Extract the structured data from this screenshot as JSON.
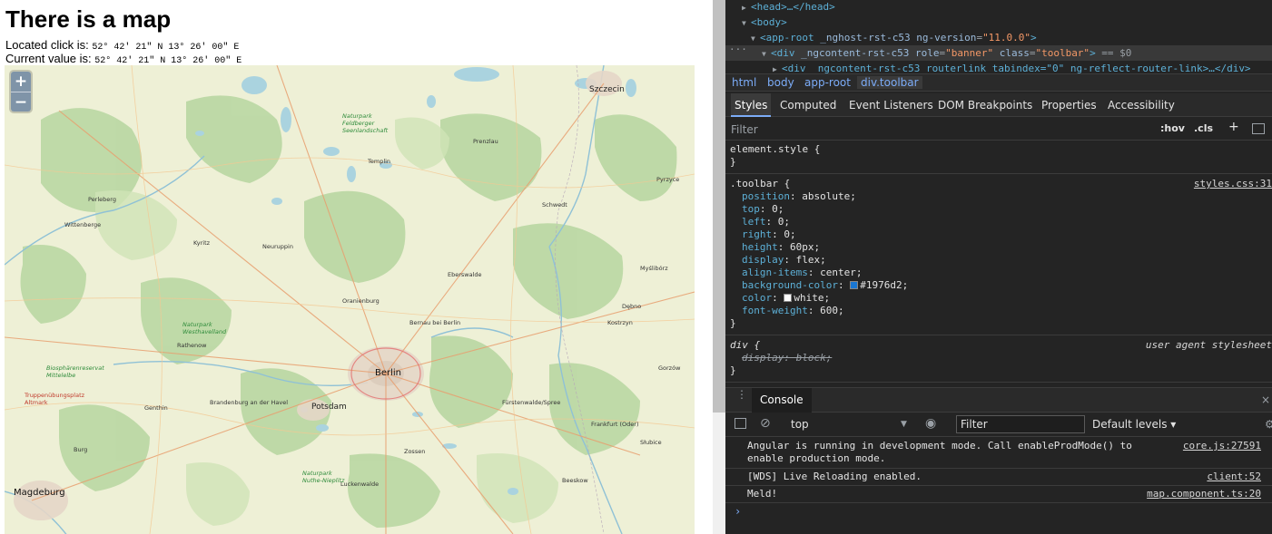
{
  "page": {
    "title": "There is a map",
    "located_label": "Located click is:",
    "located_value": "52° 42′ 21″ N 13° 26′ 00″ E",
    "current_label": "Current value is:",
    "current_value": "52° 42′ 21″ N 13° 26′ 00″ E"
  },
  "map": {
    "zoom_in": "+",
    "zoom_out": "−",
    "labels": {
      "szczecin": "Szczecin",
      "berlin": "Berlin",
      "potsdam": "Potsdam",
      "magdeburg": "Magdeburg",
      "wittenberge": "Wittenberge",
      "oranienburg": "Oranienburg",
      "eberswalde": "Eberswalde",
      "schwedt": "Schwedt",
      "neuruppin": "Neuruppin",
      "rathenow": "Rathenow",
      "brandenburg": "Brandenburg an der Havel",
      "frankfurt": "Frankfurt (Oder)",
      "prenzlau": "Prenzlau",
      "pyrzyce": "Pyrzyce",
      "luckenwalde": "Luckenwalde",
      "fuerstenwalde": "Fürstenwalde/Spree",
      "bernau": "Bernau bei Berlin",
      "templin": "Templin",
      "kyritz": "Kyritz",
      "perleberg": "Perleberg",
      "genthin": "Genthin",
      "burg": "Burg",
      "zossen": "Zossen",
      "beeskow": "Beeskow",
      "slubice": "Słubice",
      "kostrzyn": "Kostrzyn",
      "mysliborz": "Myślibórz",
      "debno": "Dębno",
      "gorzow": "Gorzów",
      "park_feldberg": "Naturpark Feldberger Seenlandschaft",
      "park_westhavelland": "Naturpark Westhavelland",
      "park_nuthe": "Naturpark Nuthe-Nieplitz",
      "park_elbe": "Biosphärenreservat Mittelelbe",
      "red_label": "Truppenübungsplatz Altmark"
    }
  },
  "devtools": {
    "dom": {
      "line1_tag": "<head>…</head>",
      "line2_tag": "<body>",
      "line3_open": "<app-root",
      "line3_attr1": "_nghost-rst-c53",
      "line3_attr2": "ng-version",
      "line3_val2": "\"11.0.0\"",
      "line3_close": ">",
      "line4_open": "<div",
      "line4_attr1": "_ngcontent-rst-c53",
      "line4_attr2": "role",
      "line4_val2": "\"banner\"",
      "line4_attr3": "class",
      "line4_val3": "\"toolbar\"",
      "line4_close": ">",
      "line4_suffix": " == $0",
      "line5": "<div _ngcontent-rst-c53 routerlink tabindex=\"0\" ng-reflect-router-link>…</div>"
    },
    "breadcrumb": [
      "html",
      "body",
      "app-root",
      "div.toolbar"
    ],
    "tabs": [
      "Styles",
      "Computed",
      "Event Listeners",
      "DOM Breakpoints",
      "Properties",
      "Accessibility"
    ],
    "filter_placeholder": "Filter",
    "hov": ":hov",
    "cls": ".cls",
    "plus": "+",
    "styles": {
      "element_style": "element.style {",
      "close_brace": "}",
      "toolbar_selector": ".toolbar {",
      "toolbar_source": "styles.css:31",
      "props": [
        {
          "name": "position",
          "value": "absolute;"
        },
        {
          "name": "top",
          "value": "0;"
        },
        {
          "name": "left",
          "value": "0;"
        },
        {
          "name": "right",
          "value": "0;"
        },
        {
          "name": "height",
          "value": "60px;"
        },
        {
          "name": "display",
          "value": "flex;"
        },
        {
          "name": "align-items",
          "value": "center;"
        },
        {
          "name": "background-color",
          "value": "#1976d2;"
        },
        {
          "name": "color",
          "value": "white;"
        },
        {
          "name": "font-weight",
          "value": "600;"
        }
      ],
      "div_selector": "div {",
      "div_source": "user agent stylesheet",
      "div_prop": "display: block;",
      "swatch_blue": "#1976d2",
      "swatch_white": "#ffffff"
    },
    "drawer": {
      "tab": "Console",
      "close": "×"
    },
    "console_toolbar": {
      "context": "top",
      "filter_placeholder": "Filter",
      "levels": "Default levels ▾"
    },
    "messages": [
      {
        "text": "Angular is running in development mode. Call enableProdMode() to enable production mode.",
        "source": "core.js:27591"
      },
      {
        "text": "[WDS] Live Reloading enabled.",
        "source": "client:52"
      },
      {
        "text": "Meld!",
        "source": "map.component.ts:20"
      }
    ],
    "prompt": "›"
  }
}
